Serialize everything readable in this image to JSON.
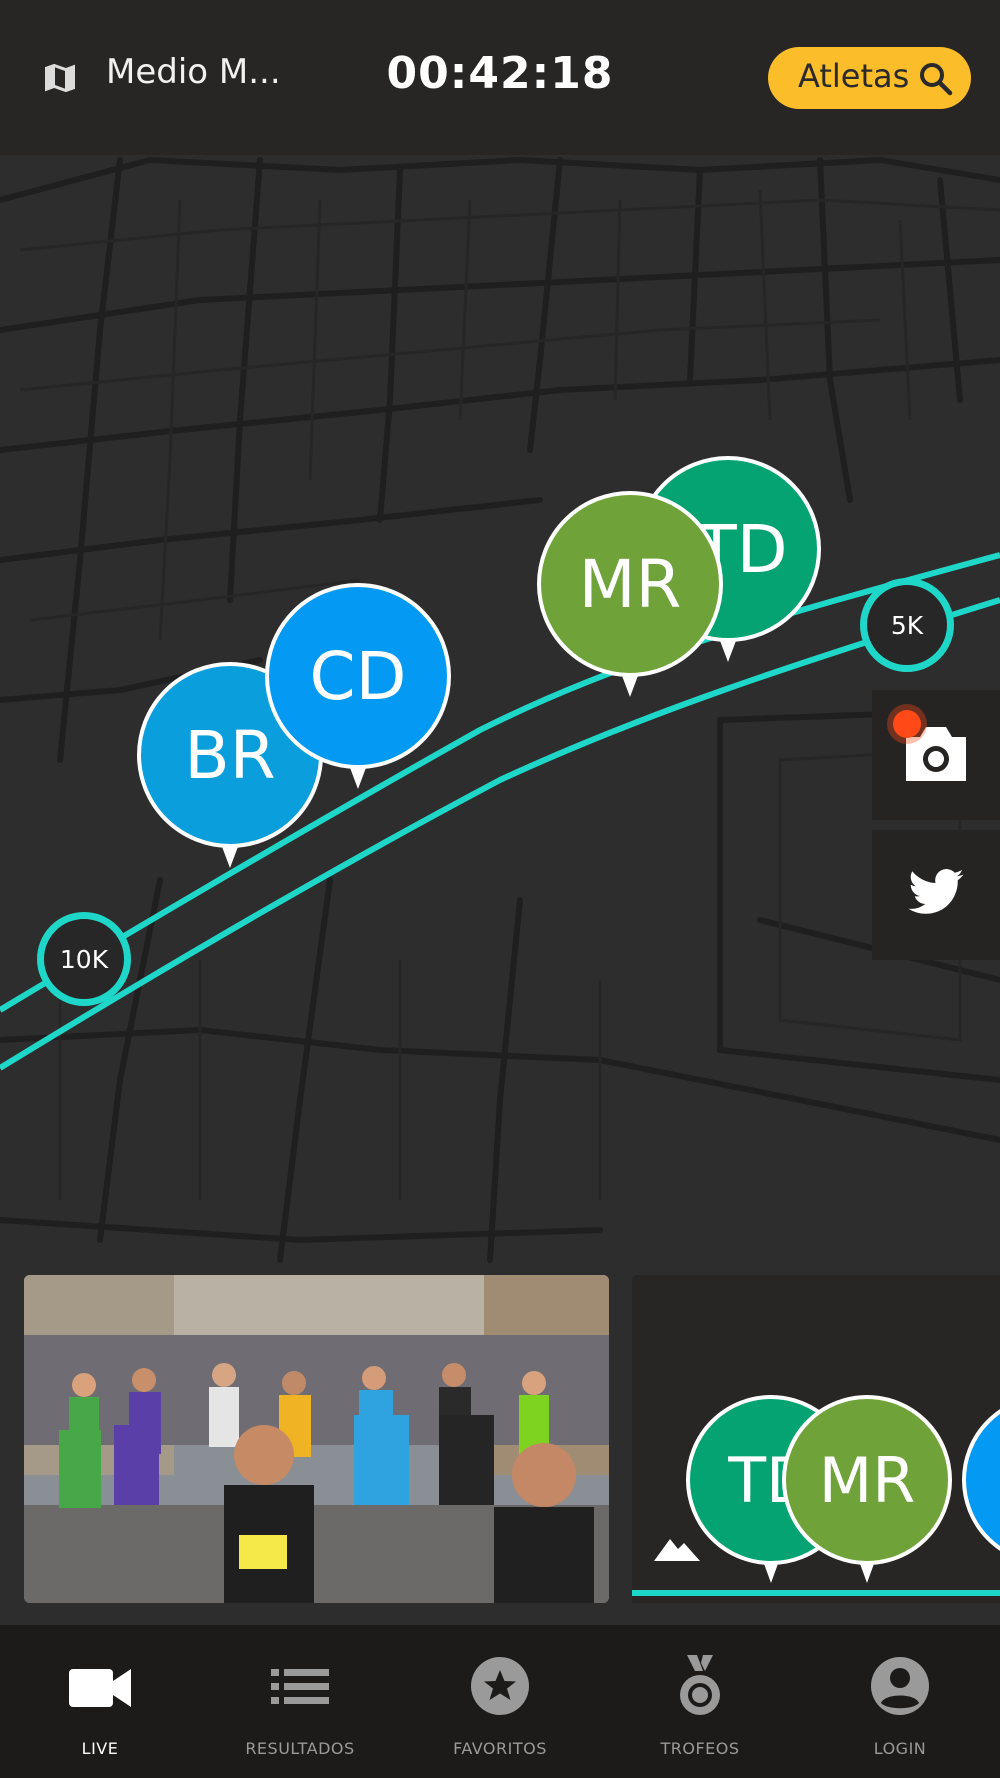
{
  "header": {
    "map_icon": "map-icon",
    "race_name": "Medio M...",
    "timer": "00:42:18",
    "search_label": "Atletas",
    "search_icon": "search-icon",
    "search_color": "#fbbd2a"
  },
  "map": {
    "track_color": "#1fd7c9",
    "km_markers": [
      {
        "label": "10K"
      },
      {
        "label": "5K"
      }
    ],
    "runners": [
      {
        "initials": "BR",
        "color": "#0a9fdc"
      },
      {
        "initials": "CD",
        "color": "#0499f2"
      },
      {
        "initials": "TD",
        "color": "#05a372"
      },
      {
        "initials": "MR",
        "color": "#6fa33a"
      }
    ],
    "side_buttons": [
      {
        "icon": "camera-icon",
        "recording_indicator_color": "#ff4a17"
      },
      {
        "icon": "twitter-icon"
      }
    ]
  },
  "media": {
    "video_card_icon": "race-photo",
    "mini_map": {
      "terrain_icon": "terrain-icon",
      "runners": [
        {
          "initials": "TD",
          "color": "#05a372"
        },
        {
          "initials": "MR",
          "color": "#6fa33a"
        },
        {
          "initials": "",
          "color": "#0499f2"
        }
      ]
    }
  },
  "bottom_nav": {
    "items": [
      {
        "label": "LIVE",
        "icon": "video-camera-icon",
        "active": true
      },
      {
        "label": "RESULTADOS",
        "icon": "list-icon",
        "active": false
      },
      {
        "label": "FAVORITOS",
        "icon": "star-icon",
        "active": false
      },
      {
        "label": "TROFEOS",
        "icon": "medal-icon",
        "active": false
      },
      {
        "label": "LOGIN",
        "icon": "account-icon",
        "active": false
      }
    ]
  }
}
